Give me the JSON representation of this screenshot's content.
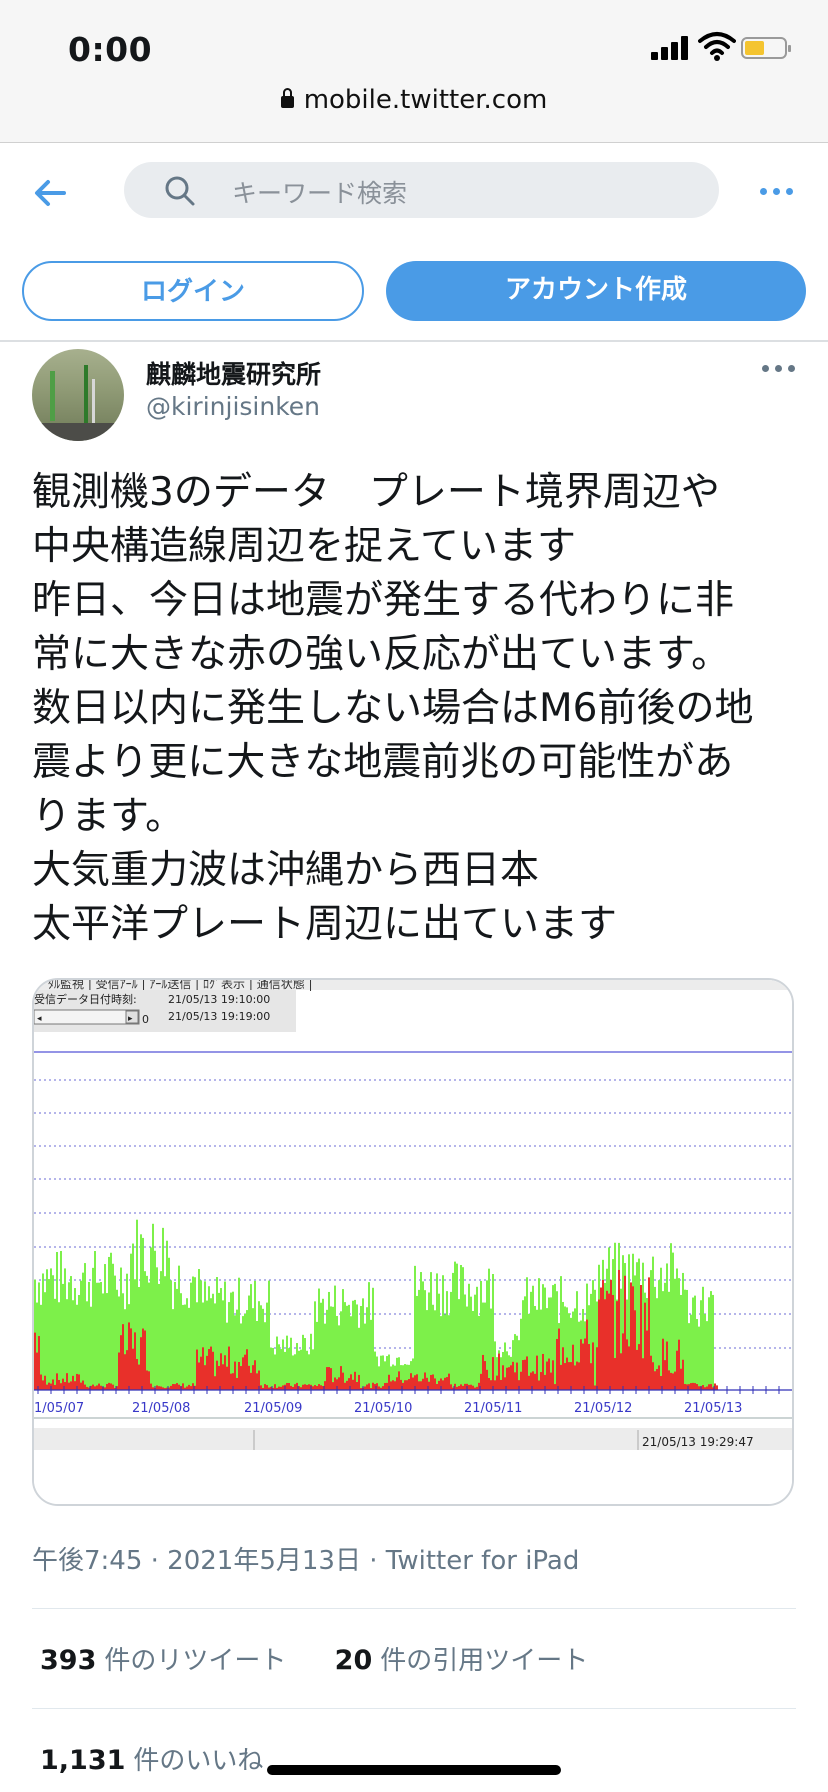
{
  "status_bar": {
    "time": "0:00",
    "url": "mobile.twitter.com",
    "battery_color": "#f4c430"
  },
  "nav": {
    "search_placeholder": "キーワード検索",
    "login_label": "ログイン",
    "signup_label": "アカウント作成",
    "accent": "#4a9be6"
  },
  "tweet": {
    "display_name": "麒麟地震研究所",
    "handle": "@kirinjisinken",
    "text": "観測機3のデータ　プレート境界周辺や\n中央構造線周辺を捉えています\n昨日、今日は地震が発生する代わりに非\n常に大きな赤の強い反応が出ています。\n数日以内に発生しない場合はM6前後の地\n震より更に大きな地震前兆の可能性があ\nります。\n大気重力波は沖縄から西日本\n太平洋プレート周辺に出ています",
    "timestamp": "午後7:45 · 2021年5月13日 · Twitter for iPad",
    "retweets": "393",
    "retweets_label": "件のリツイート",
    "quotes": "20",
    "quotes_label": "件の引用ツイート",
    "likes": "1,131",
    "likes_label": "件のいいね"
  },
  "media": {
    "menu_text": "ｼﾞﾀﾙ監視 | 受信ｱｰﾙ | ｱｰﾙ送信 | ﾛｸﾞ表示 | 通信状態 |",
    "received_label": "受信データ日付時刻:",
    "time1": "21/05/13 19:10:00",
    "time2": "21/05/13 19:19:00",
    "zero_label": "0",
    "x_labels": [
      "1/05/07",
      "21/05/08",
      "21/05/09",
      "21/05/10",
      "21/05/11",
      "21/05/12",
      "21/05/13"
    ],
    "footer_time": "21/05/13 19:29:47",
    "green": "#7df04a",
    "red": "#e8302a"
  }
}
